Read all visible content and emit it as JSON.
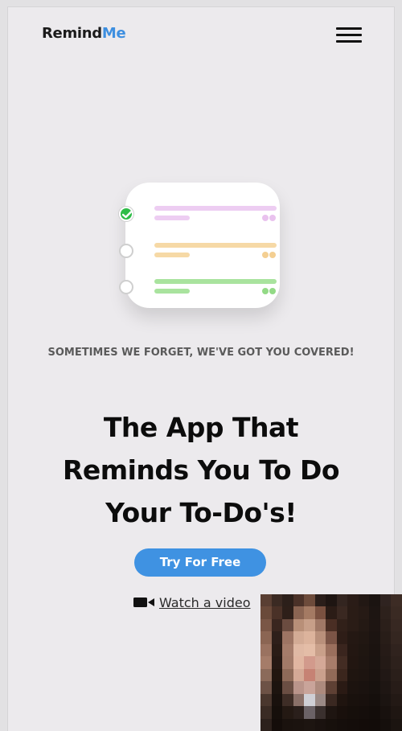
{
  "header": {
    "logo_part1": "Remind",
    "logo_part2": "Me",
    "menu_icon": "hamburger-menu-icon"
  },
  "illustration": {
    "rows": [
      {
        "state": "done",
        "color": "#edcdf2",
        "dots": "#e9c2ee"
      },
      {
        "state": "open",
        "color": "#f6d9a6",
        "dots": "#f4cf92"
      },
      {
        "state": "open",
        "color": "#a9e39e",
        "dots": "#93da86"
      }
    ],
    "check_color": "#2fbd48"
  },
  "hero": {
    "tagline": "SOMETIMES WE FORGET, WE'VE GOT YOU COVERED!",
    "headline_line1": "The App That",
    "headline_line2": "Reminds You To Do",
    "headline_line3": "Your To-Do's!",
    "cta_label": "Try For Free",
    "watch_label": "Watch a video",
    "watch_icon": "video-camera-icon"
  },
  "colors": {
    "accent": "#3e8fe0",
    "button": "#3f92e2",
    "background": "#eceaed",
    "text": "#0c0c0c"
  },
  "overlay": {
    "description_icon": "webcam-overlay"
  }
}
